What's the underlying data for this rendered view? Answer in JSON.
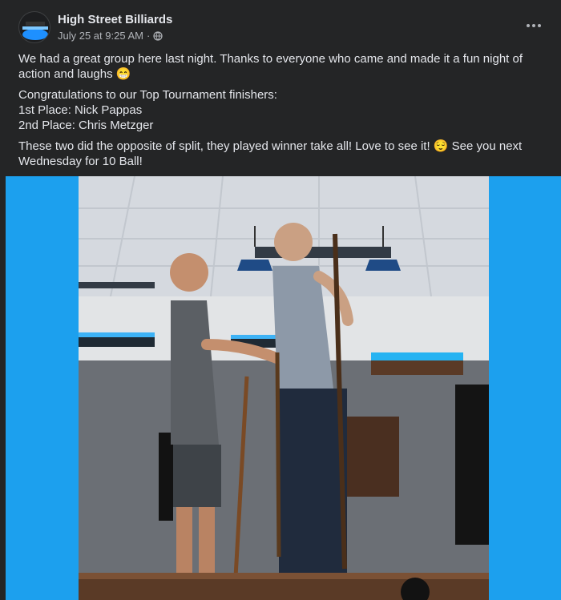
{
  "post": {
    "author": "High Street Billiards",
    "timestamp": "July 25 at 9:25 AM",
    "separator": "·",
    "privacy_icon": "globe-icon",
    "more_icon": "more-horizontal-icon",
    "avatar_icon": "billiards-avatar",
    "body": {
      "p1": "We had a great group here last night. Thanks to everyone who came and made it a fun night of action and laughs 😁",
      "p2_line1": "Congratulations to our Top Tournament finishers:",
      "p2_line2": "1st Place: Nick Pappas",
      "p2_line3": "2nd Place: Chris Metzger",
      "p3": "These two did the opposite of split, they played winner take all! Love to see it! 😌 See you next Wednesday for 10 Ball!"
    }
  },
  "theme": {
    "background": "#242526",
    "text_primary": "#e4e6eb",
    "text_secondary": "#b0b3b8",
    "photo_matte": "#1ca0ee"
  }
}
